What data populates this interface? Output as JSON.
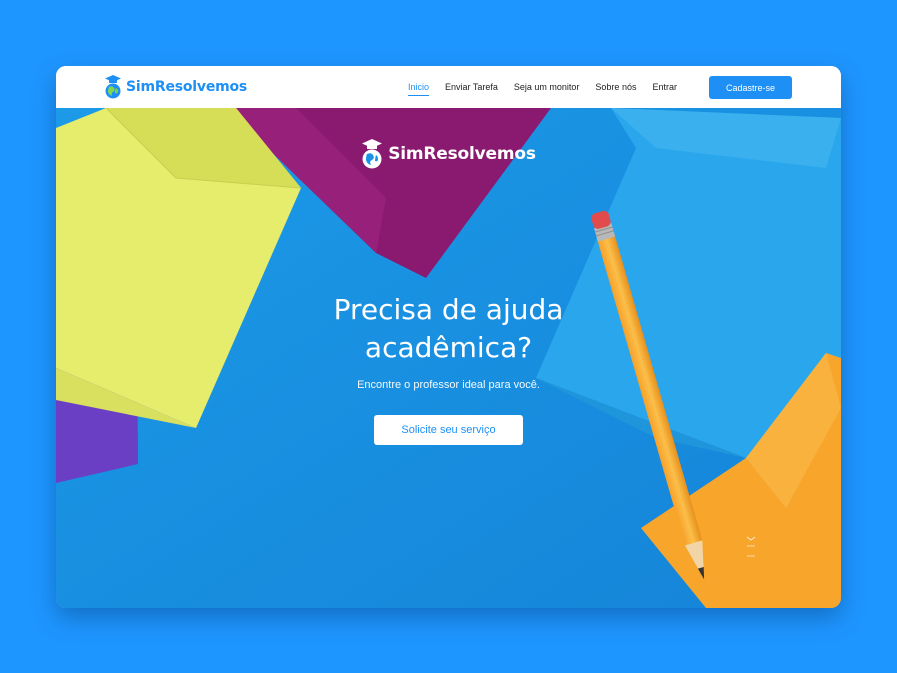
{
  "brand": {
    "name": "SimResolvemos",
    "color": "#1e90f5"
  },
  "nav": {
    "links": [
      {
        "label": "Inicio",
        "active": true
      },
      {
        "label": "Enviar Tarefa",
        "active": false
      },
      {
        "label": "Seja um monitor",
        "active": false
      },
      {
        "label": "Sobre nós",
        "active": false
      },
      {
        "label": "Entrar",
        "active": false
      }
    ],
    "signup_label": "Cadastre-se"
  },
  "hero": {
    "logo_text": "SimResolvemos",
    "title": "Precisa de ajuda acadêmica?",
    "subtitle": "Encontre o professor ideal para você.",
    "cta_label": "Solicite seu serviço"
  },
  "colors": {
    "page_background": "#1e96ff",
    "accent": "#1e90f5",
    "hero_blue": "#1a93e6"
  },
  "icons": {
    "logo": "graduation-cap-globe-icon",
    "scroll": "scroll-down-icon"
  }
}
